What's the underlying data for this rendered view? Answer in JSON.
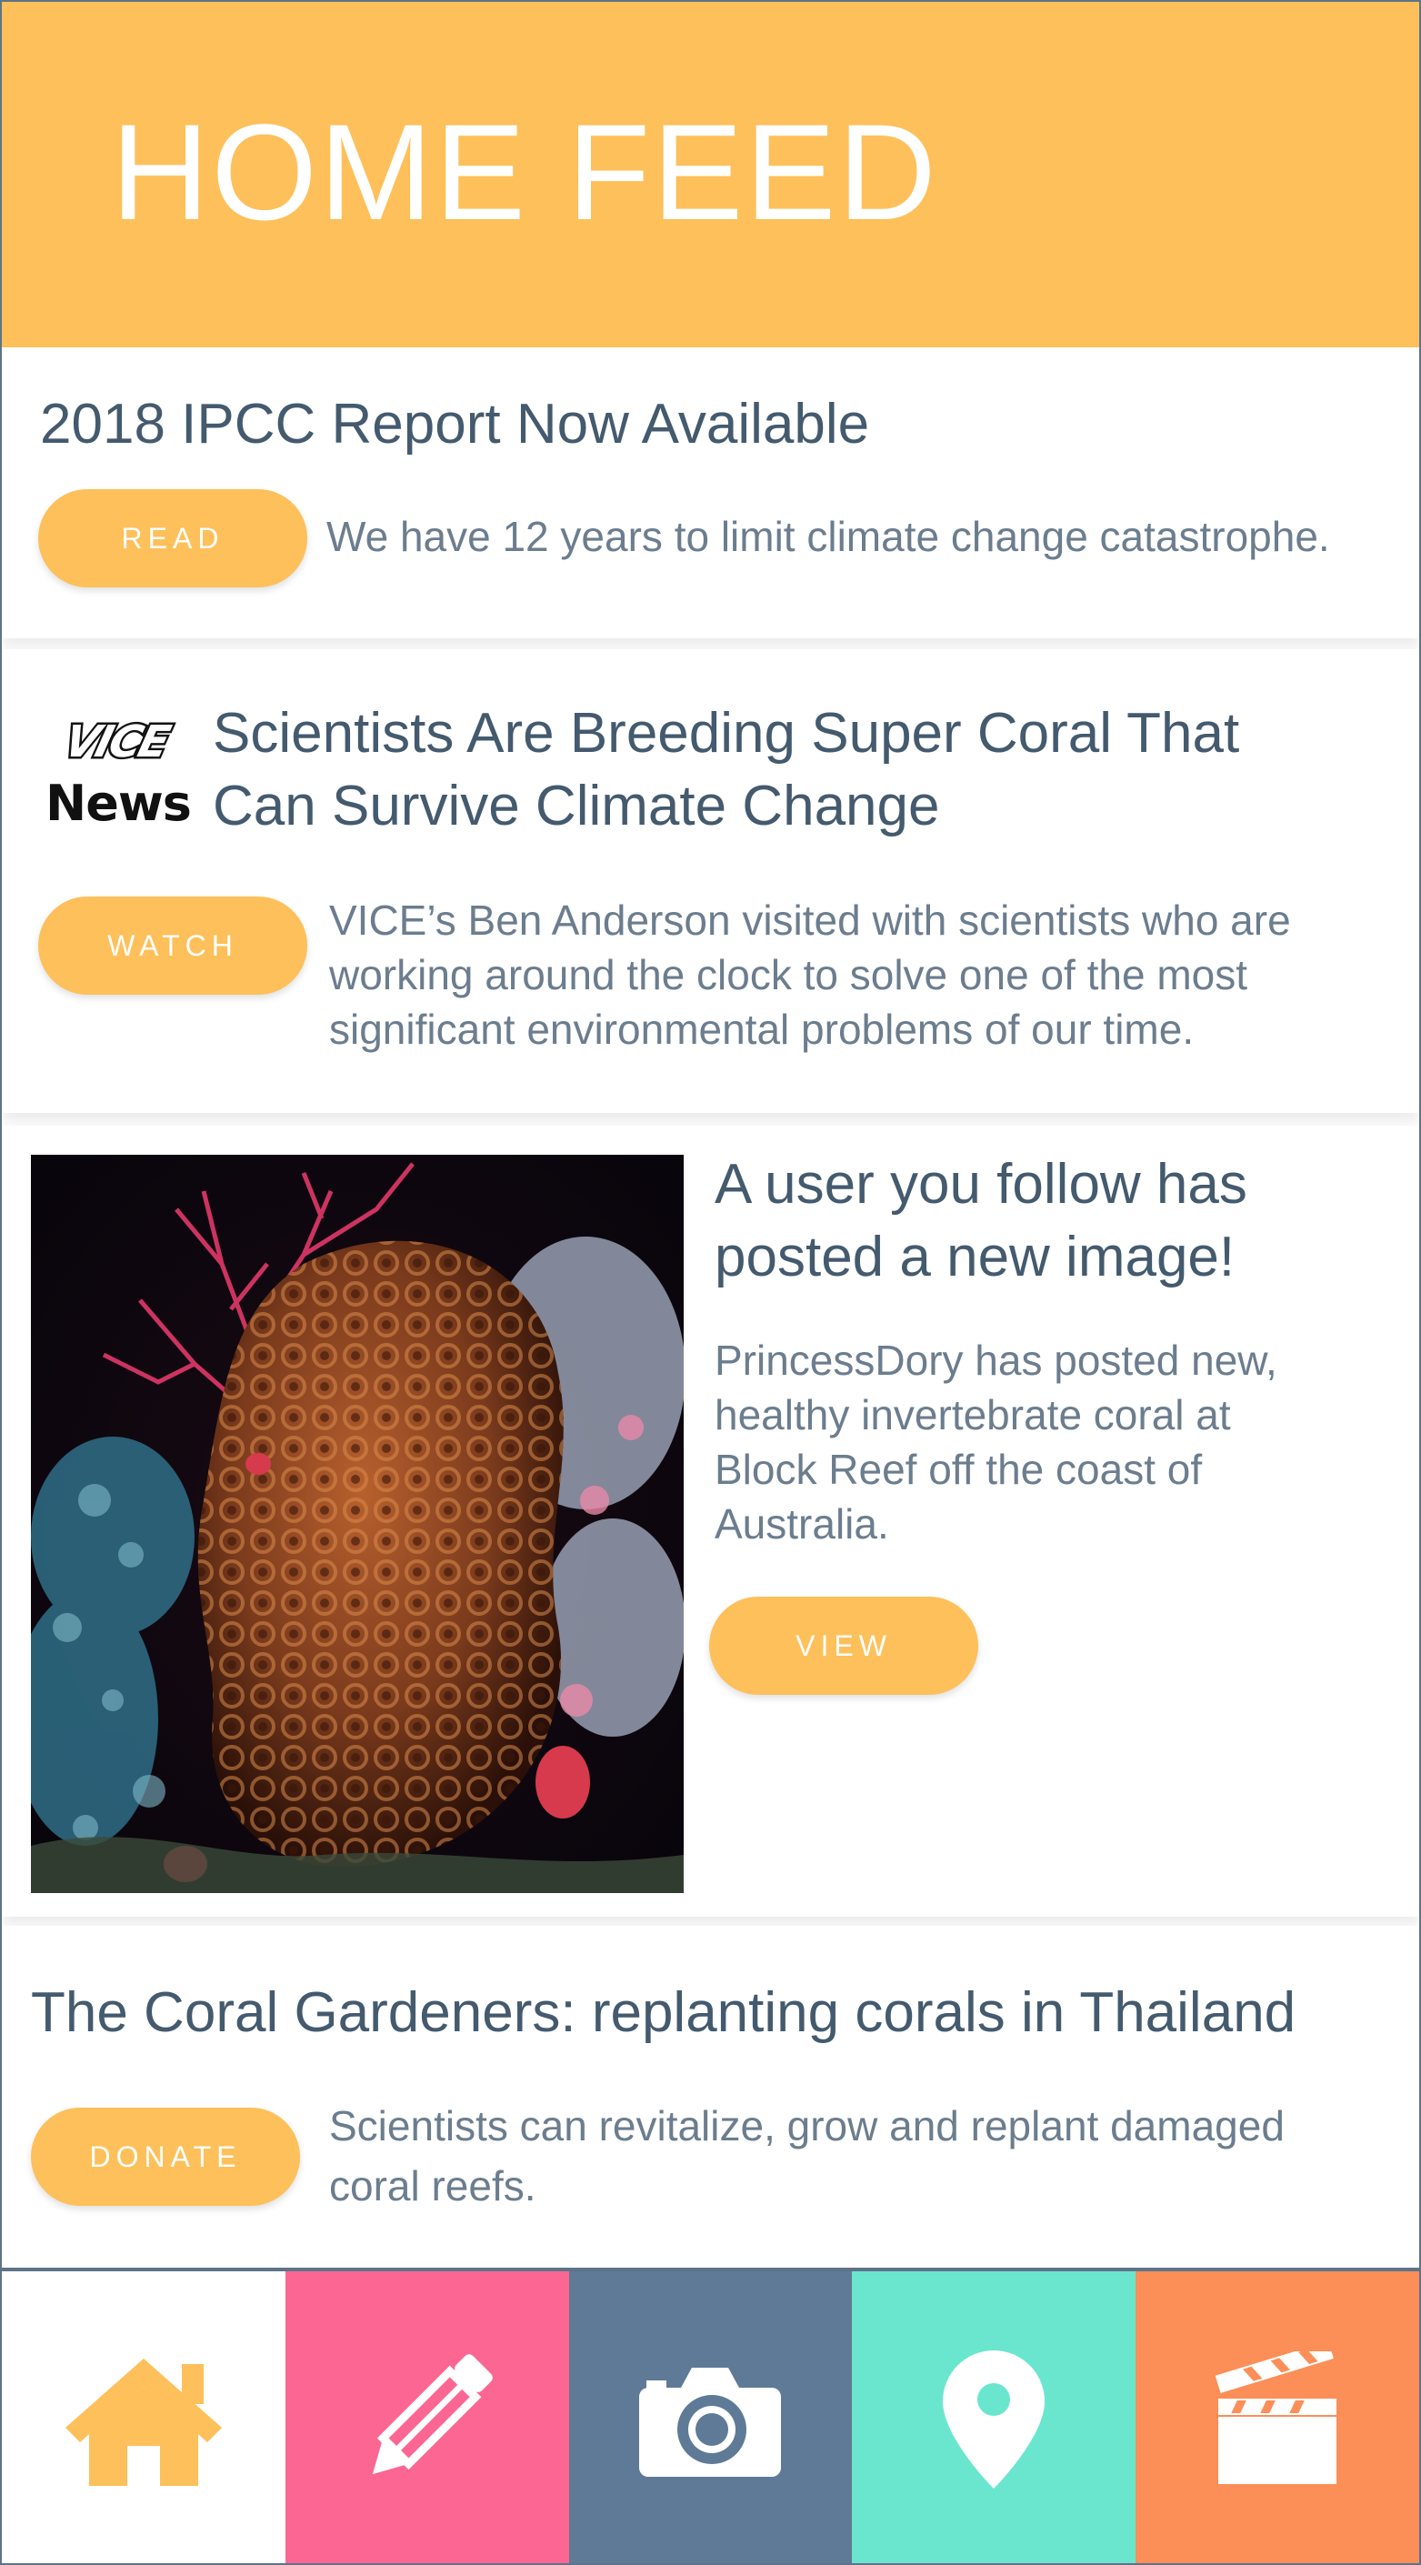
{
  "header": {
    "title": "HOME FEED"
  },
  "feed": [
    {
      "title": "2018 IPCC Report Now Available",
      "button": "READ",
      "description": "We have 12 years to limit climate change catastrophe."
    },
    {
      "source_logo": "VICE News",
      "title_line1": "Scientists Are Breeding Super Coral That",
      "title_line2": "Can Survive Climate Change",
      "button": "WATCH",
      "description_line1": "VICE’s Ben Anderson visited with scientists who are",
      "description_line2": "working around the clock to solve one of the most",
      "description_line3": "significant environmental problems of our time."
    },
    {
      "title_line1": "A user you follow has",
      "title_line2": "posted a new image!",
      "description_line1": "PrincessDory has posted new,",
      "description_line2": "healthy invertebrate coral at",
      "description_line3": "Block Reef off the coast of",
      "description_line4": "Australia.",
      "button": "VIEW"
    },
    {
      "title": "The Coral Gardeners: replanting corals in Thailand",
      "button": "DONATE",
      "description_line1": "Scientists can revitalize, grow and replant damaged",
      "description_line2": "coral reefs."
    }
  ],
  "tabbar": [
    {
      "icon": "home-icon",
      "bg": "#ffffff",
      "fg": "#fec05a"
    },
    {
      "icon": "pencil-icon",
      "bg": "#fc6693",
      "fg": "#ffffff"
    },
    {
      "icon": "camera-icon",
      "bg": "#5e7a96",
      "fg": "#ffffff"
    },
    {
      "icon": "map-pin-icon",
      "bg": "#6ae6cf",
      "fg": "#ffffff"
    },
    {
      "icon": "clapperboard-icon",
      "bg": "#fc8e58",
      "fg": "#ffffff"
    }
  ],
  "colors": {
    "accent": "#fec05a",
    "text_dark": "#445a6e",
    "text_light": "#6b7d8e",
    "border": "#5e7388"
  }
}
